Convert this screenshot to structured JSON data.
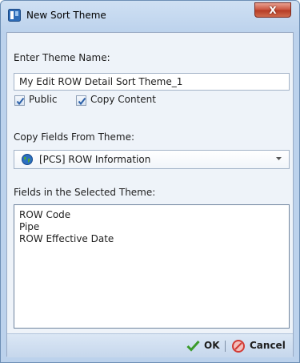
{
  "window": {
    "title": "New Sort Theme",
    "close_glyph": "X"
  },
  "theme_name": {
    "label": "Enter Theme Name:",
    "value": "My Edit ROW Detail Sort Theme_1"
  },
  "options": {
    "public": {
      "label": "Public",
      "checked": true
    },
    "copy_content": {
      "label": "Copy Content",
      "checked": true
    }
  },
  "copy_from": {
    "label": "Copy Fields From Theme:",
    "selected": "[PCS] ROW Information",
    "icon": "globe-icon"
  },
  "fields": {
    "label": "Fields in the Selected Theme:",
    "items": [
      "ROW Code",
      "Pipe",
      "ROW Effective Date"
    ]
  },
  "buttons": {
    "ok": "OK",
    "cancel": "Cancel"
  },
  "colors": {
    "accent": "#3a78c4",
    "check_green": "#3b9b2a",
    "cancel_red": "#d23a34"
  }
}
